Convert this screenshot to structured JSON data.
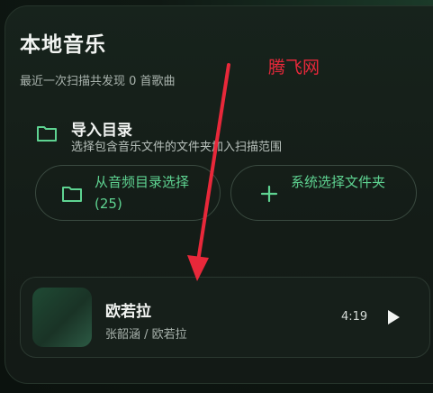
{
  "header": {
    "title": "本地音乐",
    "subtitle": "最近一次扫描共发现 0 首歌曲"
  },
  "watermark": "腾飞网",
  "import": {
    "title": "导入目录",
    "description": "选择包含音乐文件的文件夹加入扫描范围",
    "icon": "folder-icon"
  },
  "buttons": {
    "from_audio_dir": "从音频目录选择 (25)",
    "system_pick_folder": "系统选择文件夹"
  },
  "song": {
    "title": "欧若拉",
    "artist_album": "张韶涵 / 欧若拉",
    "duration": "4:19"
  },
  "colors": {
    "accent": "#5ed391",
    "annotation": "#e8283a",
    "background": "#141c17"
  }
}
